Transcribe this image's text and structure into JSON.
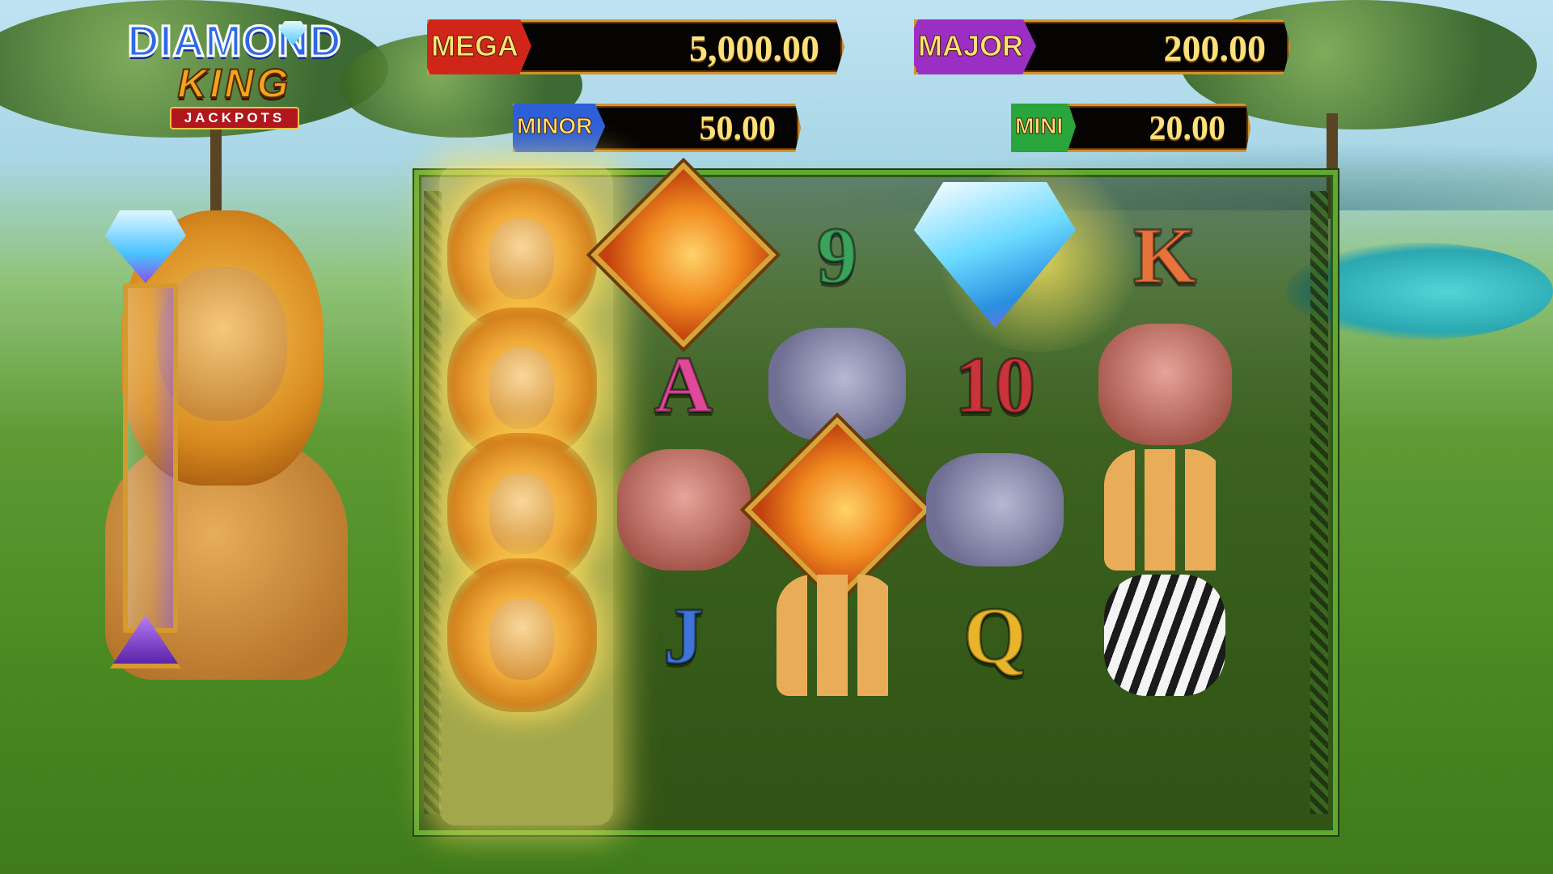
{
  "logo": {
    "line1": "DIAMOND",
    "line2": "KING",
    "line3": "JACKPOTS"
  },
  "jackpots": {
    "mega": {
      "label": "MEGA",
      "value": "5,000.00",
      "color": "#d0261a"
    },
    "major": {
      "label": "MAJOR",
      "value": "200.00",
      "color": "#9b2fc4"
    },
    "minor": {
      "label": "MINOR",
      "value": "50.00",
      "color": "#2d5fd6"
    },
    "mini": {
      "label": "MINI",
      "value": "20.00",
      "color": "#2aa53c"
    }
  },
  "reels": [
    [
      "lion",
      "lion",
      "lion",
      "lion"
    ],
    [
      "giraffe-sign",
      "A",
      "elephant",
      "J"
    ],
    [
      "9",
      "rhino",
      "giraffe-sign",
      "meerkats"
    ],
    [
      "diamond",
      "10",
      "rhino",
      "Q"
    ],
    [
      "K",
      "elephant",
      "meerkats",
      "zebra"
    ]
  ],
  "letters": {
    "A": "A",
    "J": "J",
    "9": "9",
    "10": "10",
    "Q": "Q",
    "K": "K"
  },
  "letter_colors": {
    "A": "#e0489a",
    "J": "#3e73d8",
    "9": "#3aa25a",
    "10": "#c8343a",
    "Q": "#e8b52a",
    "K": "#e8733a"
  },
  "meter": {
    "fill_fraction": 0.0
  }
}
